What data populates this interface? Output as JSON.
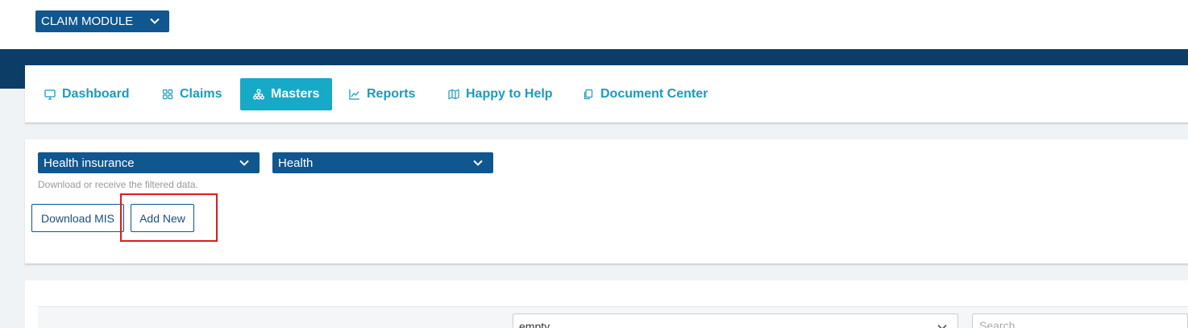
{
  "header": {
    "module_select": "CLAIM MODULE"
  },
  "nav": {
    "items": [
      {
        "label": "Dashboard",
        "icon": "monitor-icon"
      },
      {
        "label": "Claims",
        "icon": "grid-icon"
      },
      {
        "label": "Masters",
        "icon": "sitemap-icon",
        "active": true
      },
      {
        "label": "Reports",
        "icon": "line-chart-icon"
      },
      {
        "label": "Happy to Help",
        "icon": "map-icon"
      },
      {
        "label": "Document Center",
        "icon": "documents-icon"
      }
    ]
  },
  "filters": {
    "insurance_type": "Health insurance",
    "category": "Health",
    "hint": "Download or receive the filtered data."
  },
  "actions": {
    "download_mis": "Download MIS",
    "add_new": "Add New"
  },
  "table": {
    "filter_select": "empty",
    "search_placeholder": "Search"
  },
  "colors": {
    "brand_dark": "#0b3d66",
    "dropdown": "#10568f",
    "accent": "#16a9c8",
    "highlight": "#e11b1b"
  }
}
